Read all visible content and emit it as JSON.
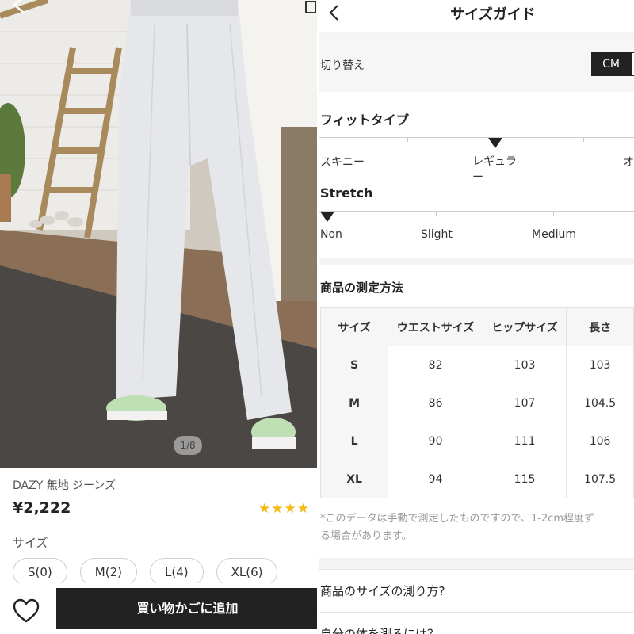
{
  "product": {
    "image_counter": "1/8",
    "title": "DAZY 無地 ジーンズ",
    "price": "¥2,222",
    "rating_stars": "★★★★",
    "size_label": "サイズ",
    "sizes": [
      "S(0)",
      "M(2)",
      "L(4)",
      "XL(6)"
    ],
    "add_to_cart": "買い物かごに追加"
  },
  "guide": {
    "title": "サイズガイド",
    "switch_label": "切り替え",
    "unit_cm": "CM",
    "fit_title": "フィットタイプ",
    "fit_labels": [
      "スキニー",
      "レギュラー",
      "オ"
    ],
    "fit_selected": "regular",
    "stretch_title": "Stretch",
    "stretch_labels": [
      "Non",
      "Slight",
      "Medium"
    ],
    "stretch_selected": "Non",
    "measure_title": "商品の測定方法",
    "table": {
      "headers": [
        "サイズ",
        "ウエストサイズ",
        "ヒップサイズ",
        "長さ"
      ],
      "rows": [
        [
          "S",
          "82",
          "103",
          "103"
        ],
        [
          "M",
          "86",
          "107",
          "104.5"
        ],
        [
          "L",
          "90",
          "111",
          "106"
        ],
        [
          "XL",
          "94",
          "115",
          "107.5"
        ]
      ]
    },
    "note_line1": "*このデータは手動で測定したものですので、1-2cm程度ず",
    "note_line2": "る場合があります。",
    "link1": "商品のサイズの測り方?",
    "link2": "自分の体を測るには？"
  }
}
